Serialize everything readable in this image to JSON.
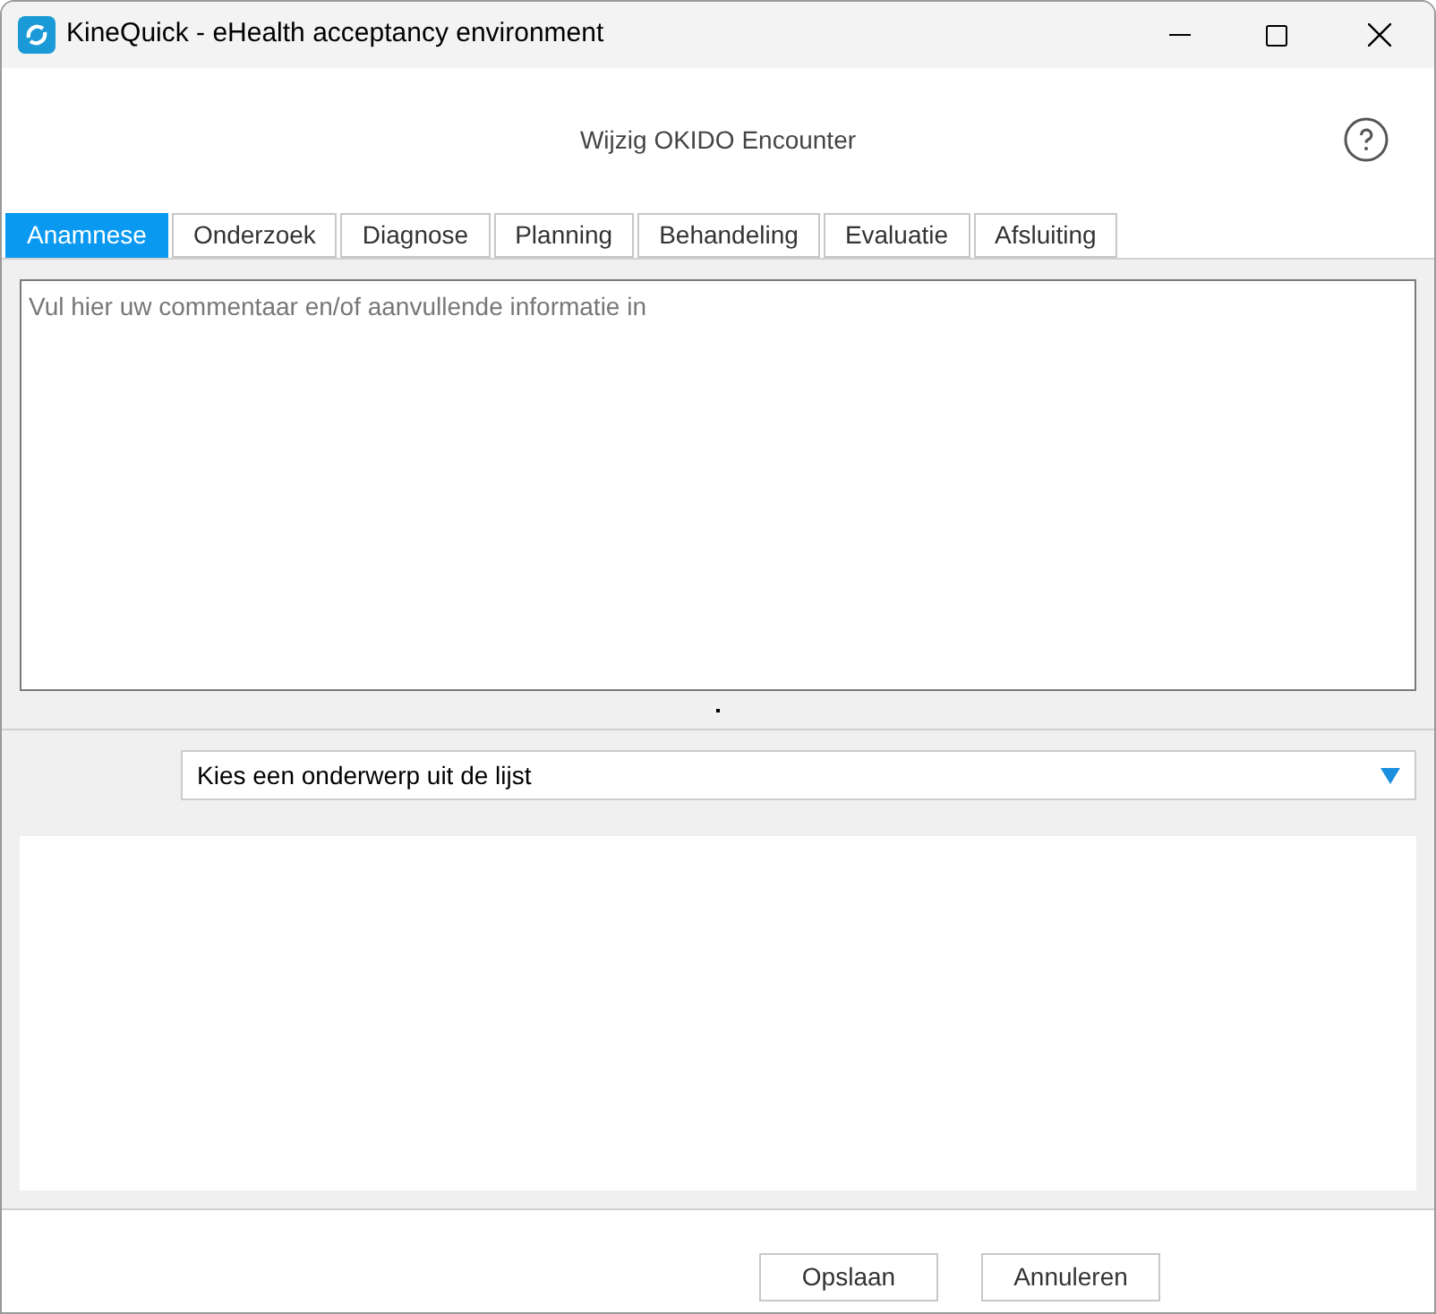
{
  "window": {
    "title": "KineQuick - eHealth acceptancy environment"
  },
  "dialog_title": "Wijzig OKIDO Encounter",
  "tabs": [
    {
      "label": "Anamnese",
      "selected": true
    },
    {
      "label": "Onderzoek",
      "selected": false
    },
    {
      "label": "Diagnose",
      "selected": false
    },
    {
      "label": "Planning",
      "selected": false
    },
    {
      "label": "Behandeling",
      "selected": false
    },
    {
      "label": "Evaluatie",
      "selected": false
    },
    {
      "label": "Afsluiting",
      "selected": false
    }
  ],
  "comment_field": {
    "placeholder": "Vul hier uw commentaar en/of aanvullende informatie in"
  },
  "subject_dropdown": {
    "value": "Kies een onderwerp uit de lijst"
  },
  "buttons": [
    "Opslaan",
    "Annuleren"
  ]
}
